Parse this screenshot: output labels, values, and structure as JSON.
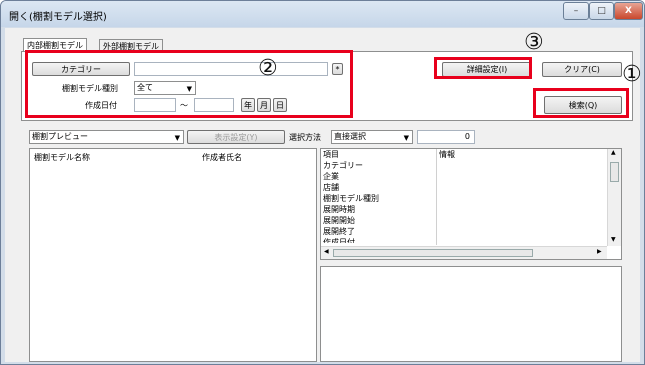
{
  "window": {
    "title": "開く(棚割モデル選択)",
    "min_glyph": "–",
    "max_glyph": "□",
    "close_glyph": "X"
  },
  "tabs": [
    {
      "label": "内部棚割モデル",
      "active": true
    },
    {
      "label": "外部棚割モデル",
      "active": false
    }
  ],
  "search_form": {
    "category_button": "カテゴリー",
    "category_value": "",
    "star_button": "*",
    "model_type_label": "棚割モデル種別",
    "model_type_value": "全て",
    "created_date_label": "作成日付",
    "date_from": "",
    "date_separator": "～",
    "date_to": "",
    "year_button": "年",
    "month_button": "月",
    "day_button": "日"
  },
  "actions": {
    "detail_settings": "詳細設定(I)",
    "clear": "クリア(C)",
    "search": "検索(Q)"
  },
  "annotations": {
    "one": "①",
    "two": "②",
    "three": "③"
  },
  "toolbar": {
    "preview_select": "棚割プレビュー",
    "display_settings": "表示設定(Y)",
    "selection_method_label": "選択方法",
    "selection_method_value": "直接選択",
    "count": "0"
  },
  "list": {
    "columns": [
      "棚割モデル名称",
      "作成者氏名"
    ]
  },
  "details": {
    "header": [
      "項目",
      "情報"
    ],
    "rows": [
      "カテゴリー",
      "企業",
      "店舗",
      "棚割モデル種別",
      "展開時期",
      "展開開始",
      "展開終了"
    ],
    "partial_row": "作成日付"
  },
  "colors": {
    "highlight": "#e8001c",
    "window_border": "#6d7f99"
  }
}
